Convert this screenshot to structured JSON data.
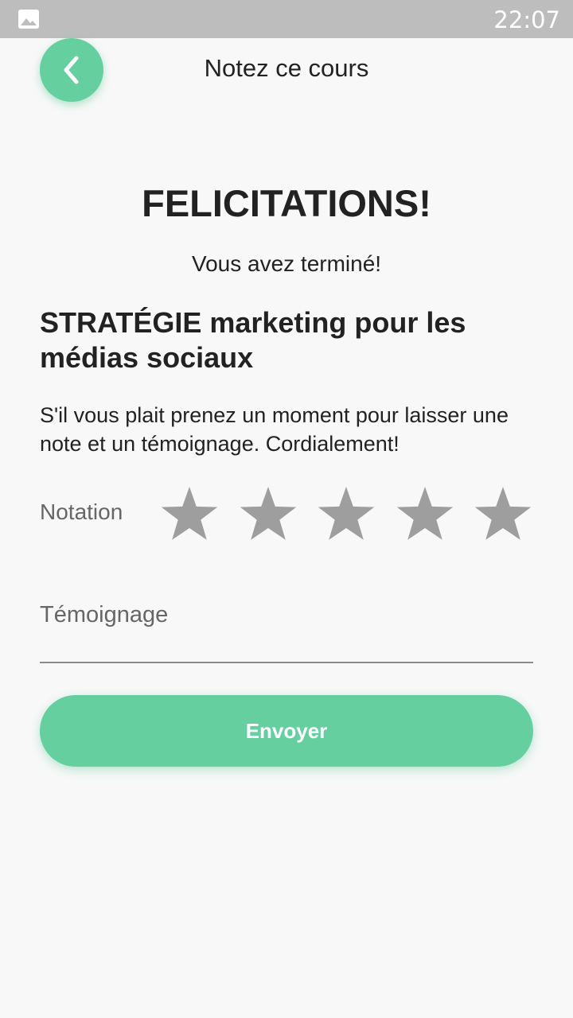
{
  "status_bar": {
    "time": "22:07",
    "left_icon": "image-icon"
  },
  "header": {
    "back_icon": "chevron-left-icon",
    "title": "Notez ce cours"
  },
  "main": {
    "heading": "FELICITATIONS!",
    "subheading": "Vous avez terminé!",
    "course_title": "STRATÉGIE marketing pour les médias sociaux",
    "message": "S'il vous plait prenez un moment pour laisser une note et un témoignage. Cordialement!",
    "rating": {
      "label": "Notation",
      "max_stars": 5,
      "selected": 0,
      "star_icon": "star-icon"
    },
    "testimony": {
      "placeholder": "Témoignage",
      "value": ""
    },
    "submit_label": "Envoyer"
  },
  "colors": {
    "accent": "#66cfa0",
    "star_inactive": "#9e9e9e",
    "status_bar": "#bdbdbd",
    "background": "#f8f8f8"
  }
}
